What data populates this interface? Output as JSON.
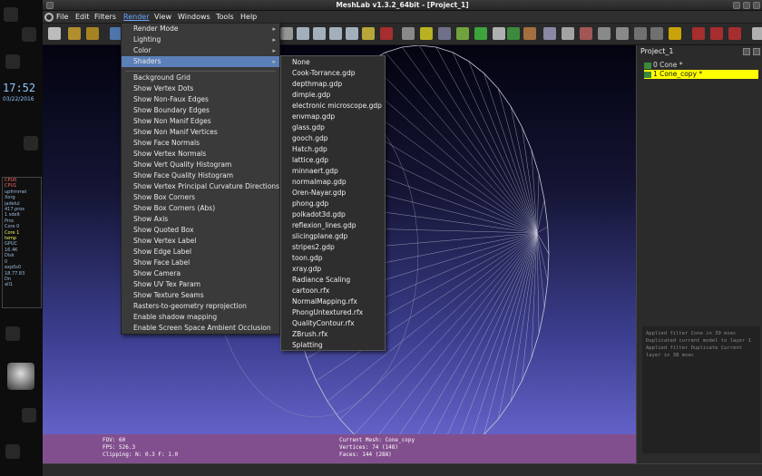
{
  "window": {
    "title": "MeshLab v1.3.2_64bit - [Project_1]"
  },
  "desktop": {
    "clock": "17:52",
    "date": "03/22/2016"
  },
  "menubar": [
    "File",
    "Edit",
    "Filters",
    "Render",
    "View",
    "Windows",
    "Tools",
    "Help"
  ],
  "render_menu": {
    "top_items": [
      {
        "label": "Render Mode",
        "submenu": true
      },
      {
        "label": "Lighting",
        "submenu": true
      },
      {
        "label": "Color",
        "submenu": true
      },
      {
        "label": "Shaders",
        "submenu": true,
        "highlighted": true
      }
    ],
    "items": [
      "Background Grid",
      "Show Vertex Dots",
      "Show Non-Faux Edges",
      "Show Boundary Edges",
      "Show Non Manif Edges",
      "Show Non Manif Vertices",
      "Show Face Normals",
      "Show Vertex Normals",
      "Show Vert Quality Histogram",
      "Show Face Quality Histogram",
      "Show Vertex Principal Curvature Directions",
      "Show Box Corners",
      "Show Box Corners (Abs)",
      "Show Axis",
      "Show Quoted Box",
      "Show Vertex Label",
      "Show Edge Label",
      "Show Face Label",
      "Show Camera",
      "Show UV Tex Param",
      "Show Texture Seams",
      "Rasters-to-geometry reprojection",
      "Enable shadow mapping",
      "Enable Screen Space Ambient Occlusion"
    ]
  },
  "shaders_menu": [
    "None",
    "Cook-Torrance.gdp",
    "depthmap.gdp",
    "dimple.gdp",
    "electronic microscope.gdp",
    "envmap.gdp",
    "glass.gdp",
    "gooch.gdp",
    "Hatch.gdp",
    "lattice.gdp",
    "minnaert.gdp",
    "normalmap.gdp",
    "Oren-Nayar.gdp",
    "phong.gdp",
    "polkadot3d.gdp",
    "reflexion_lines.gdp",
    "slicingplane.gdp",
    "stripes2.gdp",
    "toon.gdp",
    "xray.gdp",
    "Radiance Scaling",
    "cartoon.rfx",
    "NormalMapping.rfx",
    "PhongUntextured.rfx",
    "QualityContour.rfx",
    "ZBrush.rfx",
    "Splatting"
  ],
  "viewport_info": {
    "fov": "FOV: 60",
    "fps": "FPS:   526.3",
    "clipping": "Clipping: N:   0.3 F:   1.0",
    "current_mesh": "Current Mesh: Cone_copy",
    "vertices": "Vertices: 74 (148)",
    "faces": "Faces: 144 (288)"
  },
  "right_panel": {
    "title": "Project_1",
    "layers": [
      {
        "label": "0  Cone *",
        "selected": false
      },
      {
        "label": "1  Cone_copy *",
        "selected": true
      }
    ],
    "log": [
      "Applied filter Cone in 39 msec",
      "Duplicated current model to layer 1",
      "Applied filter Duplicate Current",
      "layer in 38 msec"
    ]
  },
  "sysmon": {
    "lines": [
      "CPU0",
      "CPU1",
      "upfrmmel",
      "Xorg",
      "jadelul",
      "417.prox",
      "1 sdelt",
      "Proc",
      "Core 0",
      "Core 1",
      "temp",
      "GPUC",
      "16.4K",
      "Disk",
      "0",
      "exp0s0",
      "18.77.83",
      "Dn",
      "all1"
    ]
  },
  "colors": {
    "selected_layer": "#ffff00",
    "menu_highlight": "#5b7fb8",
    "info_bar": "#824f8e"
  }
}
